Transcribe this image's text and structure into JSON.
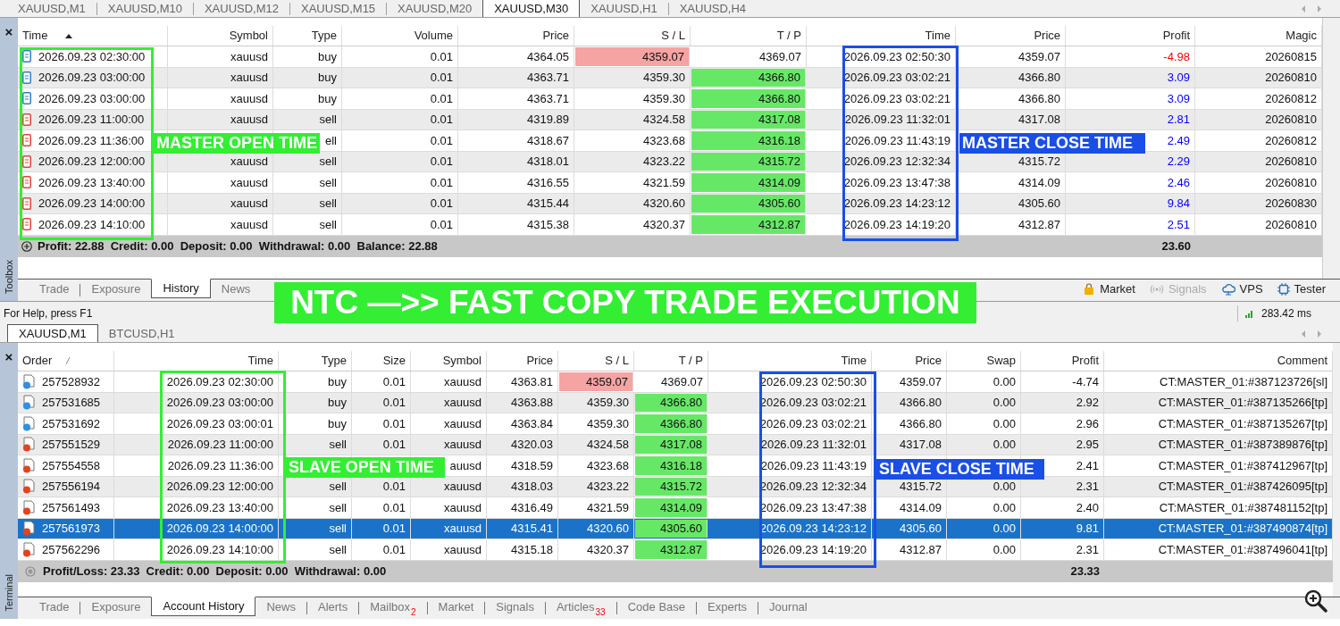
{
  "chart_tabs_top": [
    {
      "label": "XAUUSD,M1",
      "selected": false
    },
    {
      "label": "XAUUSD,M10",
      "selected": false
    },
    {
      "label": "XAUUSD,M12",
      "selected": false
    },
    {
      "label": "XAUUSD,M15",
      "selected": false
    },
    {
      "label": "XAUUSD,M20",
      "selected": false
    },
    {
      "label": "XAUUSD,M30",
      "selected": true
    },
    {
      "label": "XAUUSD,H1",
      "selected": false
    },
    {
      "label": "XAUUSD,H4",
      "selected": false
    }
  ],
  "master": {
    "side_label": "Toolbox",
    "close": "×",
    "columns": [
      "Time",
      "Symbol",
      "Type",
      "Volume",
      "Price",
      "S / L",
      "T / P",
      "Time",
      "Price",
      "Profit",
      "Magic"
    ],
    "rows": [
      {
        "kind": "buy",
        "sl_hit": true,
        "tp_hit": false,
        "loss": true,
        "cells": [
          "2026.09.23 02:30:00",
          "xauusd",
          "buy",
          "0.01",
          "4364.05",
          "4359.07",
          "4369.07",
          "2026.09.23 02:50:30",
          "4359.07",
          "-4.98",
          "20260815"
        ]
      },
      {
        "kind": "buy",
        "sl_hit": false,
        "tp_hit": true,
        "loss": false,
        "cells": [
          "2026.09.23 03:00:00",
          "xauusd",
          "buy",
          "0.01",
          "4363.71",
          "4359.30",
          "4366.80",
          "2026.09.23 03:02:21",
          "4366.80",
          "3.09",
          "20260810"
        ]
      },
      {
        "kind": "buy",
        "sl_hit": false,
        "tp_hit": true,
        "loss": false,
        "cells": [
          "2026.09.23 03:00:00",
          "xauusd",
          "buy",
          "0.01",
          "4363.71",
          "4359.30",
          "4366.80",
          "2026.09.23 03:02:21",
          "4366.80",
          "3.09",
          "20260812"
        ]
      },
      {
        "kind": "sell",
        "sl_hit": false,
        "tp_hit": true,
        "loss": false,
        "cells": [
          "2026.09.23 11:00:00",
          "xauusd",
          "sell",
          "0.01",
          "4319.89",
          "4324.58",
          "4317.08",
          "2026.09.23 11:32:01",
          "4317.08",
          "2.81",
          "20260810"
        ]
      },
      {
        "kind": "sell",
        "sl_hit": false,
        "tp_hit": true,
        "loss": false,
        "cells": [
          "2026.09.23 11:36:00",
          null,
          "ell",
          "0.01",
          "4318.67",
          "4323.68",
          "4316.18",
          "2026.09.23 11:43:19",
          null,
          "2.49",
          "20260812"
        ]
      },
      {
        "kind": "sell",
        "sl_hit": false,
        "tp_hit": true,
        "loss": false,
        "cells": [
          "2026.09.23 12:00:00",
          "xauusd",
          "sell",
          "0.01",
          "4318.01",
          "4323.22",
          "4315.72",
          "2026.09.23 12:32:34",
          "4315.72",
          "2.29",
          "20260810"
        ]
      },
      {
        "kind": "sell",
        "sl_hit": false,
        "tp_hit": true,
        "loss": false,
        "cells": [
          "2026.09.23 13:40:00",
          "xauusd",
          "sell",
          "0.01",
          "4316.55",
          "4321.59",
          "4314.09",
          "2026.09.23 13:47:38",
          "4314.09",
          "2.46",
          "20260810"
        ]
      },
      {
        "kind": "sell",
        "sl_hit": false,
        "tp_hit": true,
        "loss": false,
        "cells": [
          "2026.09.23 14:00:00",
          "xauusd",
          "sell",
          "0.01",
          "4315.44",
          "4320.60",
          "4305.60",
          "2026.09.23 14:23:12",
          "4305.60",
          "9.84",
          "20260830"
        ]
      },
      {
        "kind": "sell",
        "sl_hit": false,
        "tp_hit": true,
        "loss": false,
        "cells": [
          "2026.09.23 14:10:00",
          "xauusd",
          "sell",
          "0.01",
          "4315.38",
          "4320.37",
          "4312.87",
          "2026.09.23 14:19:20",
          "4312.87",
          "2.51",
          "20260810"
        ]
      }
    ],
    "summary": "Profit: 22.88  Credit: 0.00  Deposit: 0.00  Withdrawal: 0.00  Balance: 22.88",
    "total": "23.60",
    "annotations": [
      {
        "text": "MASTER OPEN TIME",
        "color": "#33ee33"
      },
      {
        "text": "MASTER CLOSE TIME",
        "color": "#1a4fe6"
      }
    ],
    "tabs": [
      {
        "label": "Trade",
        "selected": false
      },
      {
        "label": "Exposure",
        "selected": false
      },
      {
        "label": "History",
        "selected": true
      },
      {
        "label": "News",
        "selected": false
      }
    ],
    "tools": [
      {
        "kind": "market",
        "label": "Market",
        "disabled": false
      },
      {
        "kind": "signals",
        "label": "Signals",
        "disabled": true
      },
      {
        "kind": "vps",
        "label": "VPS",
        "disabled": false
      },
      {
        "kind": "tester",
        "label": "Tester",
        "disabled": false
      }
    ]
  },
  "banner": {
    "text": "NTC —>> FAST COPY TRADE EXECUTION"
  },
  "status_bar": {
    "help": "For Help, press F1",
    "ping": "283.42 ms"
  },
  "chart_tabs_bottom": [
    {
      "label": "XAUUSD,M1",
      "selected": true
    },
    {
      "label": "BTCUSD,H1",
      "selected": false
    }
  ],
  "slave": {
    "side_label": "Terminal",
    "close": "×",
    "columns": [
      "Order",
      "Time",
      "Type",
      "Size",
      "Symbol",
      "Price",
      "S / L",
      "T / P",
      "Time",
      "Price",
      "Swap",
      "Profit",
      "Comment"
    ],
    "rows": [
      {
        "kind": "buy",
        "sl_hit": true,
        "tp_hit": false,
        "selected": false,
        "cells": [
          "257528932",
          "2026.09.23 02:30:00",
          "buy",
          "0.01",
          "xauusd",
          "4363.81",
          "4359.07",
          "4369.07",
          "2026.09.23 02:50:30",
          "4359.07",
          "0.00",
          "-4.74",
          "CT:MASTER_01:#387123726[sl]"
        ]
      },
      {
        "kind": "buy",
        "sl_hit": false,
        "tp_hit": true,
        "selected": false,
        "cells": [
          "257531685",
          "2026.09.23 03:00:00",
          "buy",
          "0.01",
          "xauusd",
          "4363.88",
          "4359.30",
          "4366.80",
          "2026.09.23 03:02:21",
          "4366.80",
          "0.00",
          "2.92",
          "CT:MASTER_01:#387135266[tp]"
        ]
      },
      {
        "kind": "buy",
        "sl_hit": false,
        "tp_hit": true,
        "selected": false,
        "cells": [
          "257531692",
          "2026.09.23 03:00:01",
          "buy",
          "0.01",
          "xauusd",
          "4363.84",
          "4359.30",
          "4366.80",
          "2026.09.23 03:02:21",
          "4366.80",
          "0.00",
          "2.96",
          "CT:MASTER_01:#387135267[tp]"
        ]
      },
      {
        "kind": "sell",
        "sl_hit": false,
        "tp_hit": true,
        "selected": false,
        "cells": [
          "257551529",
          "2026.09.23 11:00:00",
          "sell",
          "0.01",
          "xauusd",
          "4320.03",
          "4324.58",
          "4317.08",
          "2026.09.23 11:32:01",
          "4317.08",
          "0.00",
          "2.95",
          "CT:MASTER_01:#387389876[tp]"
        ]
      },
      {
        "kind": "sell",
        "sl_hit": false,
        "tp_hit": true,
        "selected": false,
        "cells": [
          "257554558",
          "2026.09.23 11:36:00",
          null,
          null,
          "auusd",
          "4318.59",
          "4323.68",
          "4316.18",
          "2026.09.23 11:43:19",
          null,
          null,
          "2.41",
          "CT:MASTER_01:#387412967[tp]"
        ]
      },
      {
        "kind": "sell",
        "sl_hit": false,
        "tp_hit": true,
        "selected": false,
        "cells": [
          "257556194",
          "2026.09.23 12:00:00",
          "sell",
          "0.01",
          "xauusd",
          "4318.03",
          "4323.22",
          "4315.72",
          "2026.09.23 12:32:34",
          "4315.72",
          "0.00",
          "2.31",
          "CT:MASTER_01:#387426095[tp]"
        ]
      },
      {
        "kind": "sell",
        "sl_hit": false,
        "tp_hit": true,
        "selected": false,
        "cells": [
          "257561493",
          "2026.09.23 13:40:00",
          "sell",
          "0.01",
          "xauusd",
          "4316.49",
          "4321.59",
          "4314.09",
          "2026.09.23 13:47:38",
          "4314.09",
          "0.00",
          "2.40",
          "CT:MASTER_01:#387481152[tp]"
        ]
      },
      {
        "kind": "sell",
        "sl_hit": false,
        "tp_hit": true,
        "selected": true,
        "cells": [
          "257561973",
          "2026.09.23 14:00:00",
          "sell",
          "0.01",
          "xauusd",
          "4315.41",
          "4320.60",
          "4305.60",
          "2026.09.23 14:23:12",
          "4305.60",
          "0.00",
          "9.81",
          "CT:MASTER_01:#387490874[tp]"
        ]
      },
      {
        "kind": "sell",
        "sl_hit": false,
        "tp_hit": true,
        "selected": false,
        "cells": [
          "257562296",
          "2026.09.23 14:10:00",
          "sell",
          "0.01",
          "xauusd",
          "4315.18",
          "4320.37",
          "4312.87",
          "2026.09.23 14:19:20",
          "4312.87",
          "0.00",
          "2.31",
          "CT:MASTER_01:#387496041[tp]"
        ]
      }
    ],
    "summary": "Profit/Loss: 23.33  Credit: 0.00  Deposit: 0.00  Withdrawal: 0.00",
    "total": "23.33",
    "annotations": [
      {
        "text": "SLAVE OPEN TIME",
        "color": "#33ee33"
      },
      {
        "text": "SLAVE CLOSE TIME",
        "color": "#1a4fe6"
      }
    ],
    "tabs": [
      {
        "label": "Trade",
        "selected": false
      },
      {
        "label": "Exposure",
        "selected": false
      },
      {
        "label": "Account History",
        "selected": true
      },
      {
        "label": "News",
        "selected": false
      },
      {
        "label": "Alerts",
        "selected": false
      },
      {
        "label": "Mailbox",
        "badge": "2",
        "selected": false
      },
      {
        "label": "Market",
        "selected": false
      },
      {
        "label": "Signals",
        "selected": false
      },
      {
        "label": "Articles",
        "badge": "33",
        "selected": false
      },
      {
        "label": "Code Base",
        "selected": false
      },
      {
        "label": "Experts",
        "selected": false
      },
      {
        "label": "Journal",
        "selected": false
      }
    ]
  }
}
